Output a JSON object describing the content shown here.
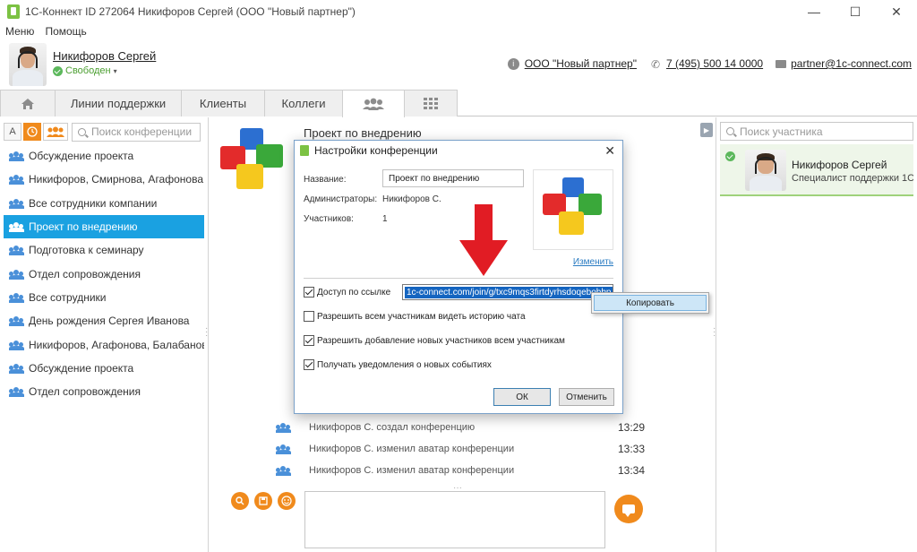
{
  "window": {
    "title": "1С-Коннект ID 272064 Никифоров Сергей  (ООО \"Новый партнер\")",
    "controls": {
      "minimize": "—",
      "maximize": "☐",
      "close": "✕"
    }
  },
  "menubar": {
    "items": [
      "Меню",
      "Помощь"
    ]
  },
  "header": {
    "user_name": "Никифоров Сергей",
    "user_status": "Свободен",
    "company": "ООО \"Новый партнер\"",
    "phone": "7 (495) 500 14 0000",
    "email": "partner@1c-connect.com"
  },
  "tabs": [
    {
      "label": "",
      "icon": "home-icon"
    },
    {
      "label": "Линии поддержки"
    },
    {
      "label": "Клиенты"
    },
    {
      "label": "Коллеги"
    },
    {
      "label": "",
      "icon": "group-icon"
    },
    {
      "label": "",
      "icon": "grid-icon"
    }
  ],
  "left": {
    "filter_a": "A",
    "search_placeholder": "Поиск конференции",
    "conferences": [
      "Обсуждение проекта",
      "Никифоров, Смирнова, Агафонова, Ми",
      "Все сотрудники компании",
      "Проект по внедрению",
      "Подготовка к семинару",
      "Отдел сопровождения",
      "Все сотрудники",
      "День рождения Сергея Иванова",
      "Никифоров, Агафонова, Балабанов, Ст",
      "Обсуждение проекта",
      "Отдел сопровождения"
    ],
    "selected_index": 3
  },
  "center": {
    "conference_title": "Проект по внедрению",
    "history": [
      {
        "text": "Никифоров С. создал конференцию",
        "time": "13:29"
      },
      {
        "text": "Никифоров С. изменил аватар конференции",
        "time": "13:33"
      },
      {
        "text": "Никифоров С. изменил аватар конференции",
        "time": "13:34"
      }
    ]
  },
  "right": {
    "search_placeholder": "Поиск участника",
    "participant": {
      "name": "Никифоров Сергей",
      "role": "Специалист поддержки 1С"
    }
  },
  "dialog": {
    "title": "Настройки конференции",
    "name_label": "Название:",
    "name_value": "Проект по внедрению",
    "admins_label": "Администраторы:",
    "admins_value": "Никифоров С.",
    "participants_label": "Участников:",
    "participants_value": "1",
    "change_link": "Изменить",
    "link_access_label": "Доступ по ссылке",
    "link_value": "1c-connect.com/join/g/txc9mqs3firtdyrhsdoqebobbp",
    "options": [
      {
        "label": "Разрешить всем участникам видеть историю чата",
        "checked": false
      },
      {
        "label": "Разрешить добавление новых участников всем участникам",
        "checked": true
      },
      {
        "label": "Получать уведомления о новых событиях",
        "checked": true
      }
    ],
    "ok_label": "ОК",
    "cancel_label": "Отменить"
  },
  "context_menu": {
    "copy_label": "Копировать"
  },
  "colors": {
    "accent": "#1aa1e1",
    "orange": "#f08a1c",
    "green": "#7cc243",
    "arrow": "#e11c24"
  }
}
